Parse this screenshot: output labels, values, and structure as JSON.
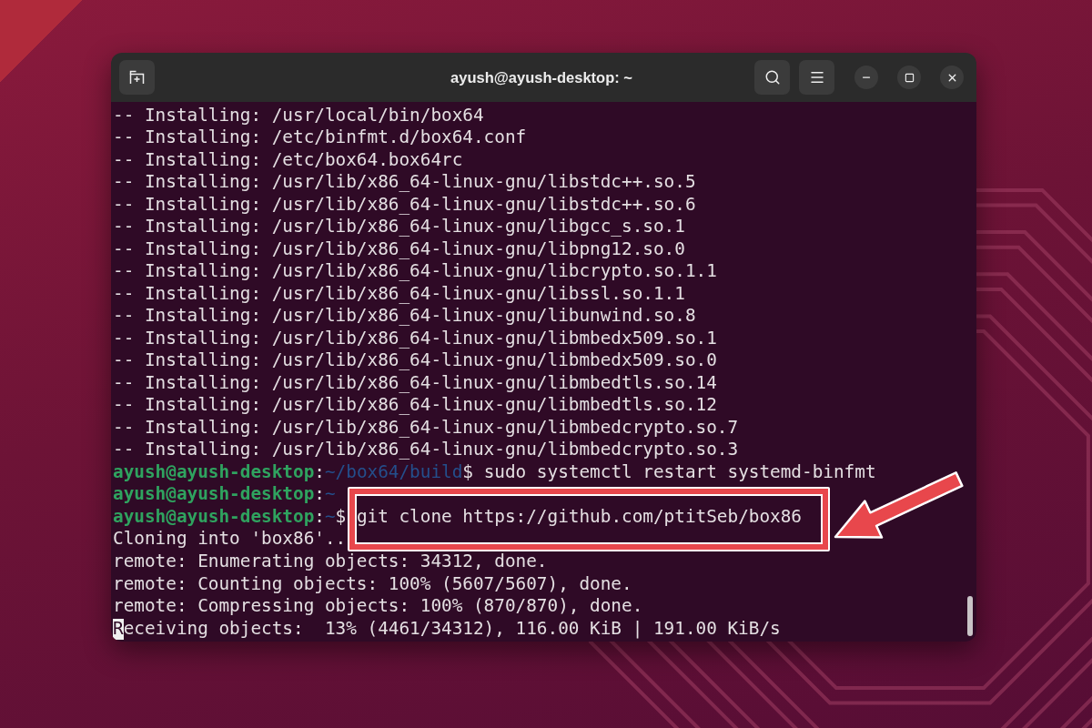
{
  "window": {
    "title": "ayush@ayush-desktop: ~"
  },
  "terminal": {
    "lines": [
      {
        "kind": "output",
        "text": "-- Installing: /usr/local/bin/box64",
        "cursor": false
      },
      {
        "kind": "output",
        "text": "-- Installing: /etc/binfmt.d/box64.conf",
        "cursor": false
      },
      {
        "kind": "output",
        "text": "-- Installing: /etc/box64.box64rc",
        "cursor": false
      },
      {
        "kind": "output",
        "text": "-- Installing: /usr/lib/x86_64-linux-gnu/libstdc++.so.5",
        "cursor": false
      },
      {
        "kind": "output",
        "text": "-- Installing: /usr/lib/x86_64-linux-gnu/libstdc++.so.6",
        "cursor": false
      },
      {
        "kind": "output",
        "text": "-- Installing: /usr/lib/x86_64-linux-gnu/libgcc_s.so.1",
        "cursor": false
      },
      {
        "kind": "output",
        "text": "-- Installing: /usr/lib/x86_64-linux-gnu/libpng12.so.0",
        "cursor": false
      },
      {
        "kind": "output",
        "text": "-- Installing: /usr/lib/x86_64-linux-gnu/libcrypto.so.1.1",
        "cursor": false
      },
      {
        "kind": "output",
        "text": "-- Installing: /usr/lib/x86_64-linux-gnu/libssl.so.1.1",
        "cursor": false
      },
      {
        "kind": "output",
        "text": "-- Installing: /usr/lib/x86_64-linux-gnu/libunwind.so.8",
        "cursor": false
      },
      {
        "kind": "output",
        "text": "-- Installing: /usr/lib/x86_64-linux-gnu/libmbedx509.so.1",
        "cursor": false
      },
      {
        "kind": "output",
        "text": "-- Installing: /usr/lib/x86_64-linux-gnu/libmbedx509.so.0",
        "cursor": false
      },
      {
        "kind": "output",
        "text": "-- Installing: /usr/lib/x86_64-linux-gnu/libmbedtls.so.14",
        "cursor": false
      },
      {
        "kind": "output",
        "text": "-- Installing: /usr/lib/x86_64-linux-gnu/libmbedtls.so.12",
        "cursor": false
      },
      {
        "kind": "output",
        "text": "-- Installing: /usr/lib/x86_64-linux-gnu/libmbedcrypto.so.7",
        "cursor": false
      },
      {
        "kind": "output",
        "text": "-- Installing: /usr/lib/x86_64-linux-gnu/libmbedcrypto.so.3",
        "cursor": false
      },
      {
        "kind": "prompt",
        "segments": [
          {
            "kind": "user",
            "text": "ayush@ayush-desktop"
          },
          {
            "kind": "plain",
            "text": ":"
          },
          {
            "kind": "path",
            "text": "~/box64/build"
          },
          {
            "kind": "plain",
            "text": "$ sudo systemctl restart systemd-binfmt"
          }
        ],
        "cursor": false
      },
      {
        "kind": "prompt",
        "segments": [
          {
            "kind": "user",
            "text": "ayush@ayush-desktop"
          },
          {
            "kind": "plain",
            "text": ":"
          },
          {
            "kind": "path",
            "text": "~"
          }
        ],
        "cursor": false
      },
      {
        "kind": "prompt",
        "segments": [
          {
            "kind": "user",
            "text": "ayush@ayush-desktop"
          },
          {
            "kind": "plain",
            "text": ":"
          },
          {
            "kind": "path",
            "text": "~"
          },
          {
            "kind": "plain",
            "text": "$ git clone https://github.com/ptitSeb/box86"
          }
        ],
        "cursor": false
      },
      {
        "kind": "output",
        "text": "Cloning into 'box86'..",
        "cursor": false
      },
      {
        "kind": "output",
        "text": "remote: Enumerating objects: 34312, done.",
        "cursor": false
      },
      {
        "kind": "output",
        "text": "remote: Counting objects: 100% (5607/5607), done.",
        "cursor": false
      },
      {
        "kind": "output",
        "text": "remote: Compressing objects: 100% (870/870), done.",
        "cursor": false
      },
      {
        "kind": "output",
        "text": "Receiving objects:  13% (4461/34312), 116.00 KiB | 191.00 KiB/s",
        "cursor": true
      }
    ]
  }
}
